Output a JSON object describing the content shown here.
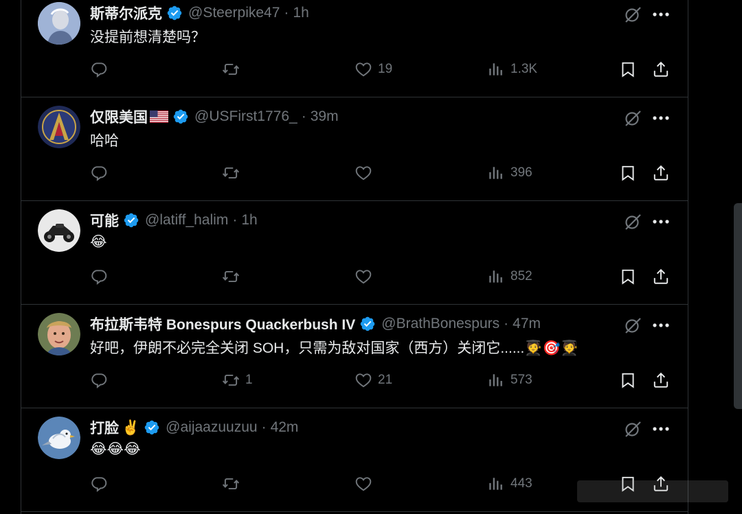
{
  "tweets": [
    {
      "name": "斯蒂尔派克",
      "handle": "@Steerpike47",
      "separator": "·",
      "time": "1h",
      "text": "没提前想清楚吗？",
      "reply_count": "",
      "retweet_count": "",
      "like_count": "19",
      "view_count": "1.3K",
      "avatar_icon": "portrait-avatar",
      "flag": null
    },
    {
      "name": "仅限美国",
      "handle": "@USFirst1776_",
      "separator": "·",
      "time": "39m",
      "text": "哈哈",
      "reply_count": "",
      "retweet_count": "",
      "like_count": "",
      "view_count": "396",
      "avatar_icon": "emblem-avatar",
      "flag": "us-flag"
    },
    {
      "name": "可能",
      "handle": "@latiff_halim",
      "separator": "·",
      "time": "1h",
      "text": "😂",
      "reply_count": "",
      "retweet_count": "",
      "like_count": "",
      "view_count": "852",
      "avatar_icon": "motorcycle-avatar",
      "flag": null
    },
    {
      "name": "布拉斯韦特 Bonespurs Quackerbush IV",
      "handle": "@BrathBonespurs",
      "separator": "·",
      "time": "47m",
      "text": "好吧，伊朗不必完全关闭 SOH，只需为敌对国家（西方）关闭它......🧑‍🎓🎯🧑‍🎓",
      "reply_count": "",
      "retweet_count": "1",
      "like_count": "21",
      "view_count": "573",
      "avatar_icon": "face-avatar",
      "flag": null
    },
    {
      "name": "打脸",
      "hand_emoji": "✌️",
      "handle": "@aijaazuuzuu",
      "separator": "·",
      "time": "42m",
      "text": "😂😂😂",
      "reply_count": "",
      "retweet_count": "",
      "like_count": "",
      "view_count": "443",
      "avatar_icon": "bird-avatar",
      "flag": null
    }
  ],
  "colors": {
    "background": "#000000",
    "text": "#e7e9ea",
    "muted": "#71767b",
    "border": "#2f3336",
    "verified": "#1d9bf0"
  },
  "icons": {
    "reply": "reply-icon",
    "retweet": "retweet-icon",
    "like": "heart-icon",
    "views": "views-icon",
    "bookmark": "bookmark-icon",
    "share": "share-icon",
    "grok": "grok-icon",
    "more": "more-icon",
    "verified": "verified-badge-icon"
  }
}
